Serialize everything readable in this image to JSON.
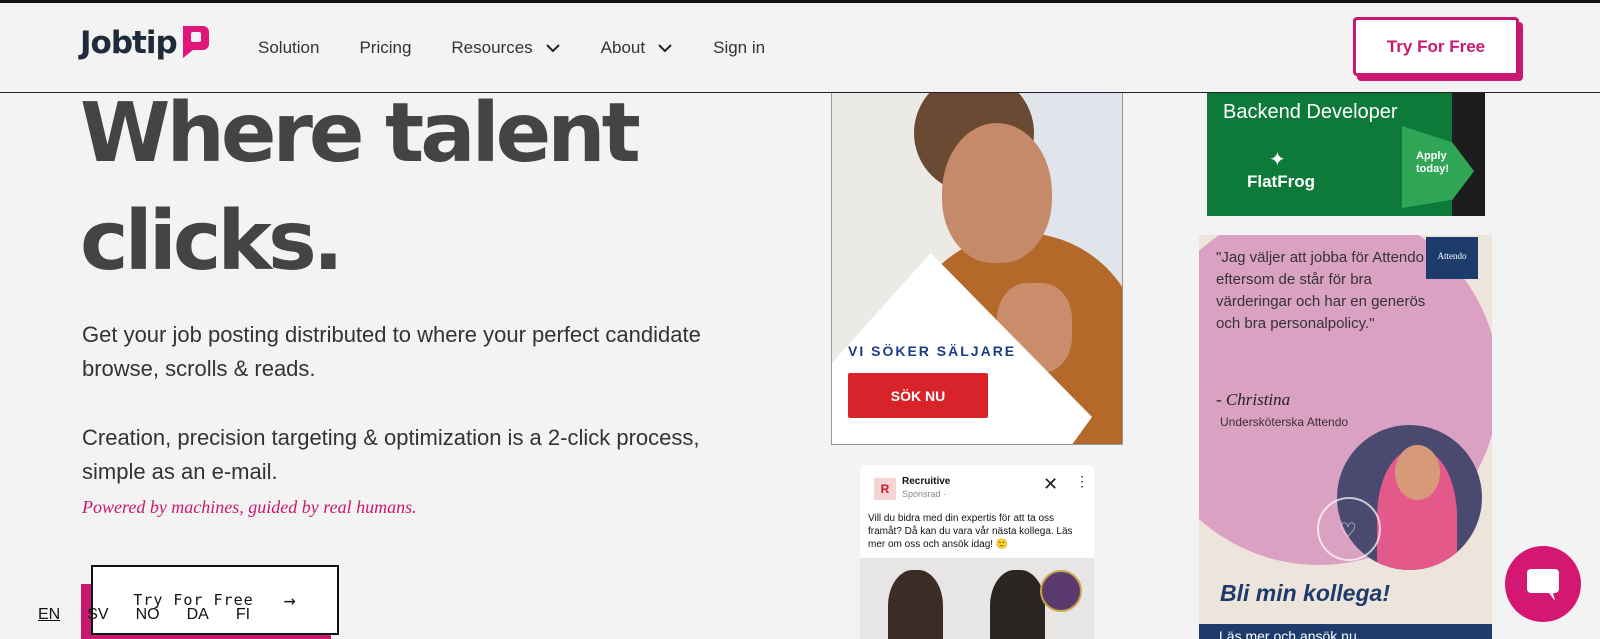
{
  "header": {
    "logo_text": "Jobtip",
    "nav": [
      {
        "label": "Solution",
        "dropdown": false
      },
      {
        "label": "Pricing",
        "dropdown": false
      },
      {
        "label": "Resources",
        "dropdown": true
      },
      {
        "label": "About",
        "dropdown": true
      },
      {
        "label": "Sign in",
        "dropdown": false
      }
    ],
    "cta_label": "Try For Free"
  },
  "hero": {
    "title_line1": "Where talent",
    "title_line2": "clicks.",
    "para1": "Get your job posting distributed to where your perfect candidate browse, scrolls & reads.",
    "para2": "Creation, precision targeting & optimization is a 2-click process, simple as an e-mail.",
    "tagline": "Powered by machines, guided by real humans.",
    "cta_label": "Try For Free",
    "cta_arrow": "→"
  },
  "languages": [
    {
      "code": "EN",
      "active": true
    },
    {
      "code": "SV",
      "active": false
    },
    {
      "code": "NO",
      "active": false
    },
    {
      "code": "DA",
      "active": false
    },
    {
      "code": "FI",
      "active": false
    }
  ],
  "ads": {
    "seller": {
      "headline": "VI SÖKER SÄLJARE",
      "button": "SÖK NU"
    },
    "flatfrog": {
      "title": "Backend Developer",
      "brand": "FlatFrog",
      "apply": "Apply today!"
    },
    "attendo": {
      "logo": "Attendo",
      "quote": "\"Jag väljer att jobba för Attendo eftersom de står för bra värderingar och har en generös och bra personalpolicy.\"",
      "signature": "- Christina",
      "role": "Undersköterska Attendo",
      "slogan": "Bli min kollega!",
      "footer": "Läs mer och ansök nu"
    },
    "recruitive": {
      "name": "Recruitive",
      "sponsored": "Sponsrad · ",
      "text": "Vill du bidra med din expertis för att ta oss framåt? Då kan du vara vår nästa kollega. Läs mer om oss och ansök idag! 🙂"
    }
  },
  "colors": {
    "accent": "#c8186f",
    "text": "#333333",
    "heading": "#444444"
  }
}
